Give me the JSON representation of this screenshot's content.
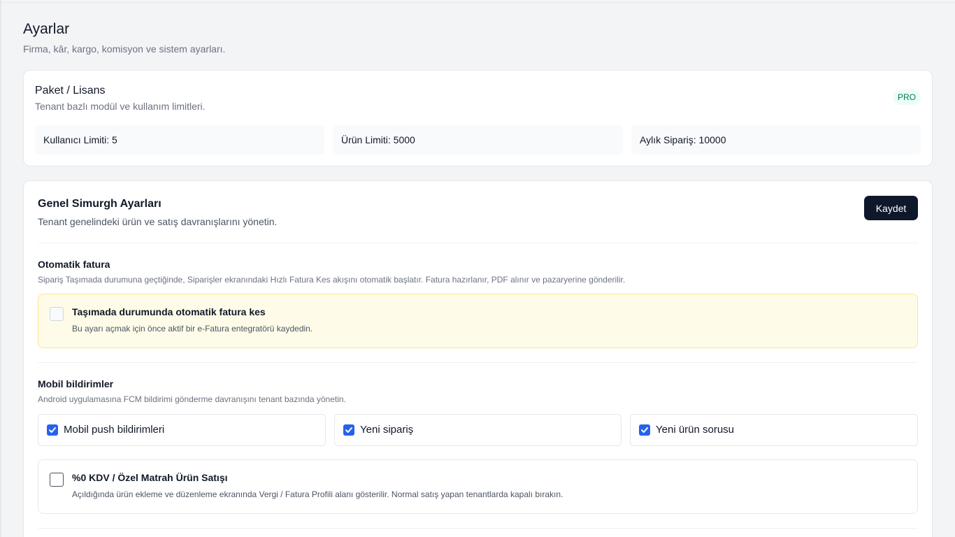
{
  "page": {
    "title": "Ayarlar",
    "subtitle": "Firma, kâr, kargo, komisyon ve sistem ayarları."
  },
  "license": {
    "title": "Paket / Lisans",
    "subtitle": "Tenant bazlı modül ve kullanım limitleri.",
    "badge": "PRO",
    "limits": [
      "Kullanıcı Limiti: 5",
      "Ürün Limiti: 5000",
      "Aylık Sipariş: 10000"
    ]
  },
  "settings": {
    "title": "Genel Simurgh Ayarları",
    "subtitle": "Tenant genelindeki ürün ve satış davranışlarını yönetin.",
    "save_label": "Kaydet",
    "auto_invoice": {
      "title": "Otomatik fatura",
      "description": "Sipariş Taşımada durumuna geçtiğinde, Siparişler ekranındaki Hızlı Fatura Kes akışını otomatik başlatır. Fatura hazırlanır, PDF alınır ve pazaryerine gönderilir.",
      "option_label": "Taşımada durumunda otomatik fatura kes",
      "option_hint": "Bu ayarı açmak için önce aktif bir e-Fatura entegratörü kaydedin.",
      "checked": false,
      "disabled": true
    },
    "mobile_notifications": {
      "title": "Mobil bildirimler",
      "description": "Android uygulamasına FCM bildirimi gönderme davranışını tenant bazında yönetin.",
      "options": [
        {
          "label": "Mobil push bildirimleri",
          "checked": true
        },
        {
          "label": "Yeni sipariş",
          "checked": true
        },
        {
          "label": "Yeni ürün sorusu",
          "checked": true
        }
      ]
    },
    "kdv": {
      "title": "%0 KDV / Özel Matrah Ürün Satışı",
      "description": "Açıldığında ürün ekleme ve düzenleme ekranında Vergi / Fatura Profili alanı gösterilir. Normal satış yapan tenantlarda kapalı bırakın.",
      "checked": false
    }
  },
  "colors": {
    "primary_button": "#0f172a",
    "checkbox_checked": "#2563eb",
    "warning_bg": "#fefce8",
    "warning_border": "#fde68a",
    "pro_badge_text": "#047857"
  }
}
